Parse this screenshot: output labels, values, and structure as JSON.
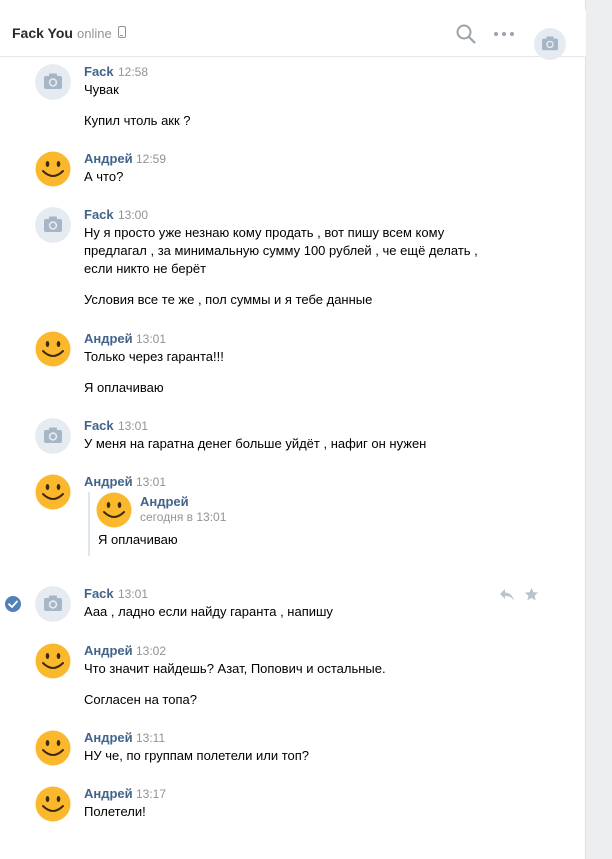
{
  "header": {
    "name": "Fack You",
    "status": "online",
    "icons": [
      "phone-icon",
      "search-icon",
      "more-icon",
      "camera-avatar"
    ]
  },
  "colors": {
    "author": "#42648b",
    "meta": "#939393",
    "avatar_placeholder": "#e5ebf1",
    "camera": "#a7b6c6",
    "smiley": "#fbb82c"
  },
  "messages": [
    {
      "author": "Fack",
      "time": "12:58",
      "avatar": "camera",
      "lines": [
        "Чувак",
        "Купил чтоль акк ?"
      ]
    },
    {
      "author": "Андрей",
      "time": "12:59",
      "avatar": "smiley",
      "lines": [
        "А что?"
      ]
    },
    {
      "author": "Fack",
      "time": "13:00",
      "avatar": "camera",
      "lines": [
        "Ну я просто уже незнаю кому продать , вот пишу всем кому",
        "предлагал , за минимальную сумму 100 рублей , че ещё делать ,",
        "если никто не берёт",
        "Условия все те же , пол суммы и я тебе данные"
      ]
    },
    {
      "author": "Андрей",
      "time": "13:01",
      "avatar": "smiley",
      "lines": [
        "Только через гаранта!!!",
        "Я оплачиваю"
      ]
    },
    {
      "author": "Fack",
      "time": "13:01",
      "avatar": "camera",
      "lines": [
        "У меня на гаратна денег больше уйдёт , нафиг он нужен"
      ]
    },
    {
      "author": "Андрей",
      "time": "13:01",
      "avatar": "smiley",
      "lines": [],
      "forwarded": {
        "author": "Андрей",
        "time": "сегодня в 13:01",
        "text": "Я оплачиваю"
      }
    },
    {
      "author": "Fack",
      "time": "13:01",
      "avatar": "camera",
      "lines": [
        "Ааа , ладно если найду гаранта , напишу"
      ],
      "read_check": true,
      "actions": [
        "reply-icon",
        "star-icon"
      ]
    },
    {
      "author": "Андрей",
      "time": "13:02",
      "avatar": "smiley",
      "lines": [
        "Что значит найдешь? Азат, Попович и остальные.",
        "Согласен на топа?"
      ]
    },
    {
      "author": "Андрей",
      "time": "13:11",
      "avatar": "smiley",
      "lines": [
        "НУ че, по группам полетели или топ?"
      ]
    },
    {
      "author": "Андрей",
      "time": "13:17",
      "avatar": "smiley",
      "lines": [
        "Полетели!"
      ]
    }
  ]
}
